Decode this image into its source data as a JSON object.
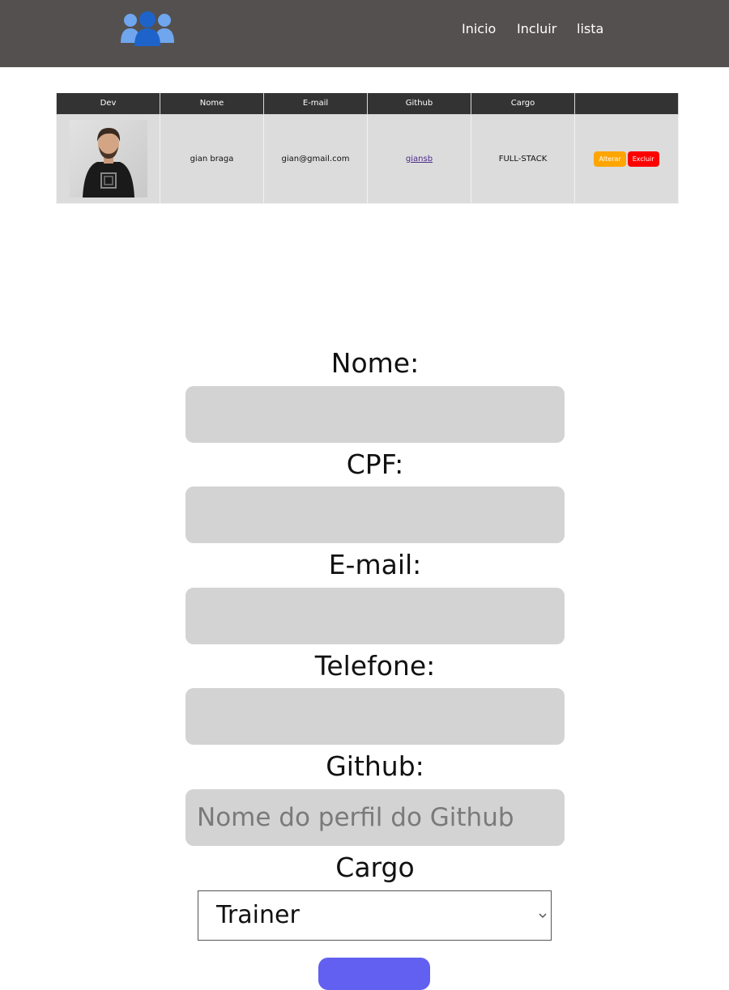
{
  "header": {
    "logo": "users-group-icon",
    "nav": [
      "Inicio",
      "Incluir",
      "lista"
    ],
    "colors": {
      "background": "#545050",
      "text": "#ffffff"
    }
  },
  "table": {
    "columns": [
      "Dev",
      "Nome",
      "E-mail",
      "Github",
      "Cargo",
      ""
    ],
    "rows": [
      {
        "photo": "developer-photo",
        "nome": "gian braga",
        "email": "gian@gmail.com",
        "github": "giansb",
        "cargo": "FULL-STACK",
        "actions": {
          "alterar": "Alterar",
          "excluir": "Excluir"
        }
      }
    ],
    "colors": {
      "header": "#333333",
      "cell": "#dcdcdc",
      "alterar": "#ffa500",
      "excluir": "#ff0000"
    }
  },
  "form": {
    "nome_label": "Nome:",
    "nome_value": "",
    "cpf_label": "CPF:",
    "cpf_value": "",
    "email_label": "E-mail:",
    "email_value": "",
    "telefone_label": "Telefone:",
    "telefone_value": "",
    "github_label": "Github:",
    "github_placeholder": "Nome do perfil do Github",
    "cargo_label": "Cargo",
    "cargo_selected": "Trainer",
    "colors": {
      "input": "#d3d3d3",
      "submit": "#6160f0"
    }
  }
}
